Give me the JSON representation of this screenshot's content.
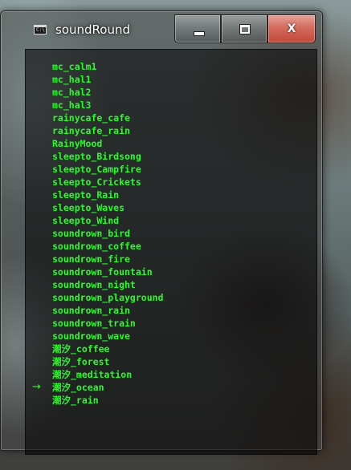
{
  "window": {
    "title": "soundRound",
    "app_icon_text": "C:\\",
    "close_glyph": "X"
  },
  "console": {
    "text_color": "#25ff25",
    "selected_index": 25,
    "selection_marker": "→",
    "items": [
      {
        "label": "mc_calm1"
      },
      {
        "label": "mc_hal1"
      },
      {
        "label": "mc_hal2"
      },
      {
        "label": "mc_hal3"
      },
      {
        "label": "rainycafe_cafe"
      },
      {
        "label": "rainycafe_rain"
      },
      {
        "label": "RainyMood"
      },
      {
        "label": "sleepto_Birdsong"
      },
      {
        "label": "sleepto_Campfire"
      },
      {
        "label": "sleepto_Crickets"
      },
      {
        "label": "sleepto_Rain"
      },
      {
        "label": "sleepto_Waves"
      },
      {
        "label": "sleepto_Wind"
      },
      {
        "label": "soundrown_bird"
      },
      {
        "label": "soundrown_coffee"
      },
      {
        "label": "soundrown_fire"
      },
      {
        "label": "soundrown_fountain"
      },
      {
        "label": "soundrown_night"
      },
      {
        "label": "soundrown_playground"
      },
      {
        "label": "soundrown_rain"
      },
      {
        "label": "soundrown_train"
      },
      {
        "label": "soundrown_wave"
      },
      {
        "label": "潮汐_coffee"
      },
      {
        "label": "潮汐_forest"
      },
      {
        "label": "潮汐_meditation"
      },
      {
        "label": "潮汐_ocean"
      },
      {
        "label": "潮汐_rain"
      }
    ]
  }
}
